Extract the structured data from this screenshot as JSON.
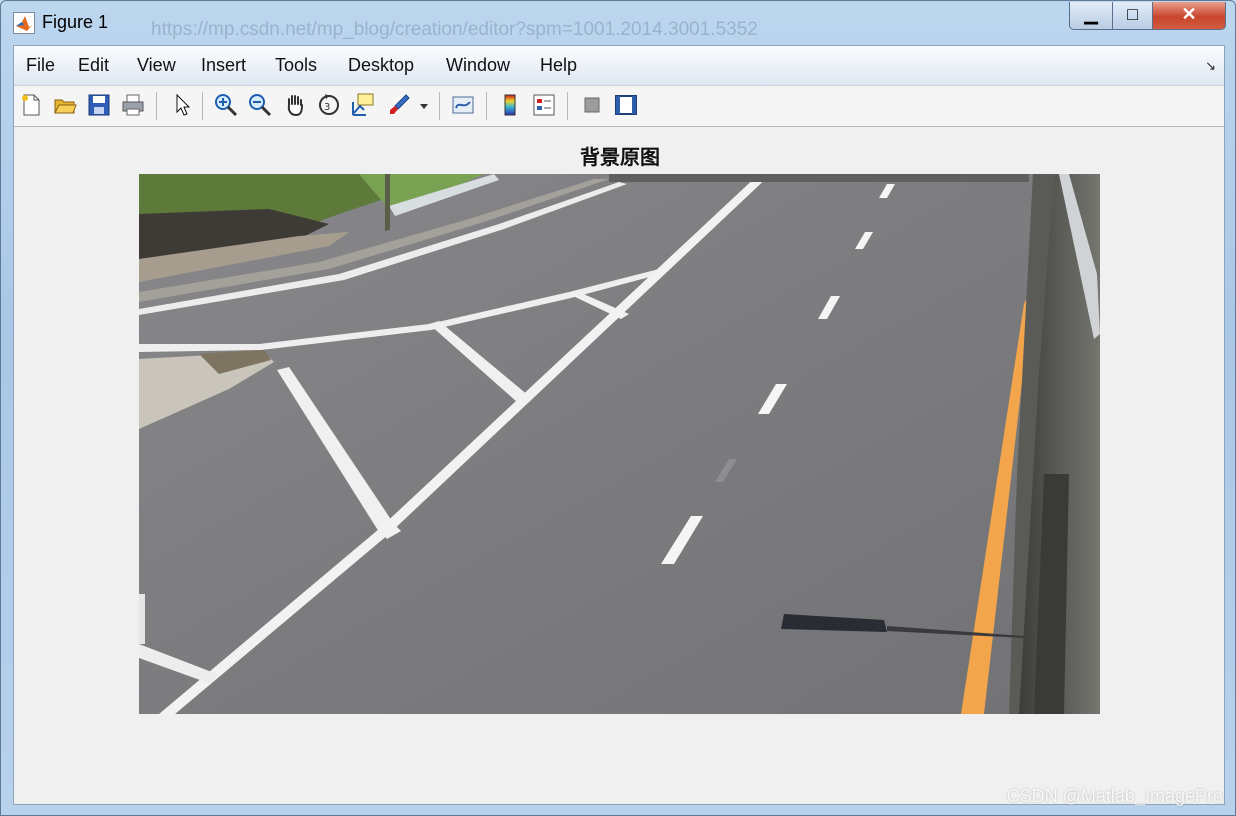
{
  "window": {
    "title": "Figure 1",
    "background_text": "https://mp.csdn.net/mp_blog/creation/editor?spm=1001.2014.3001.5352",
    "minimize_glyph": "▁",
    "maximize_glyph": "□",
    "close_glyph": "✕"
  },
  "menu": {
    "items": [
      "File",
      "Edit",
      "View",
      "Insert",
      "Tools",
      "Desktop",
      "Window",
      "Help"
    ],
    "overflow_glyph": "↘"
  },
  "toolbar": {
    "icons": [
      "new-figure-icon",
      "open-file-icon",
      "save-icon",
      "print-icon",
      "pointer-icon",
      "zoom-in-icon",
      "zoom-out-icon",
      "pan-icon",
      "rotate-3d-icon",
      "data-cursor-icon",
      "brush-icon",
      "brush-dropdown-icon",
      "link-plot-icon",
      "insert-colorbar-icon",
      "insert-legend-icon",
      "hide-plot-tools-icon",
      "show-plot-tools-icon"
    ]
  },
  "figure": {
    "title": "背景原图",
    "image_description_colors": {
      "asphalt": "#7b7b7d",
      "lane_marking": "#f2f2f2",
      "edge_line": "#f2a54a",
      "grass": "#5d7a3a"
    }
  },
  "watermark": "CSDN @Matlab_ImagePro"
}
